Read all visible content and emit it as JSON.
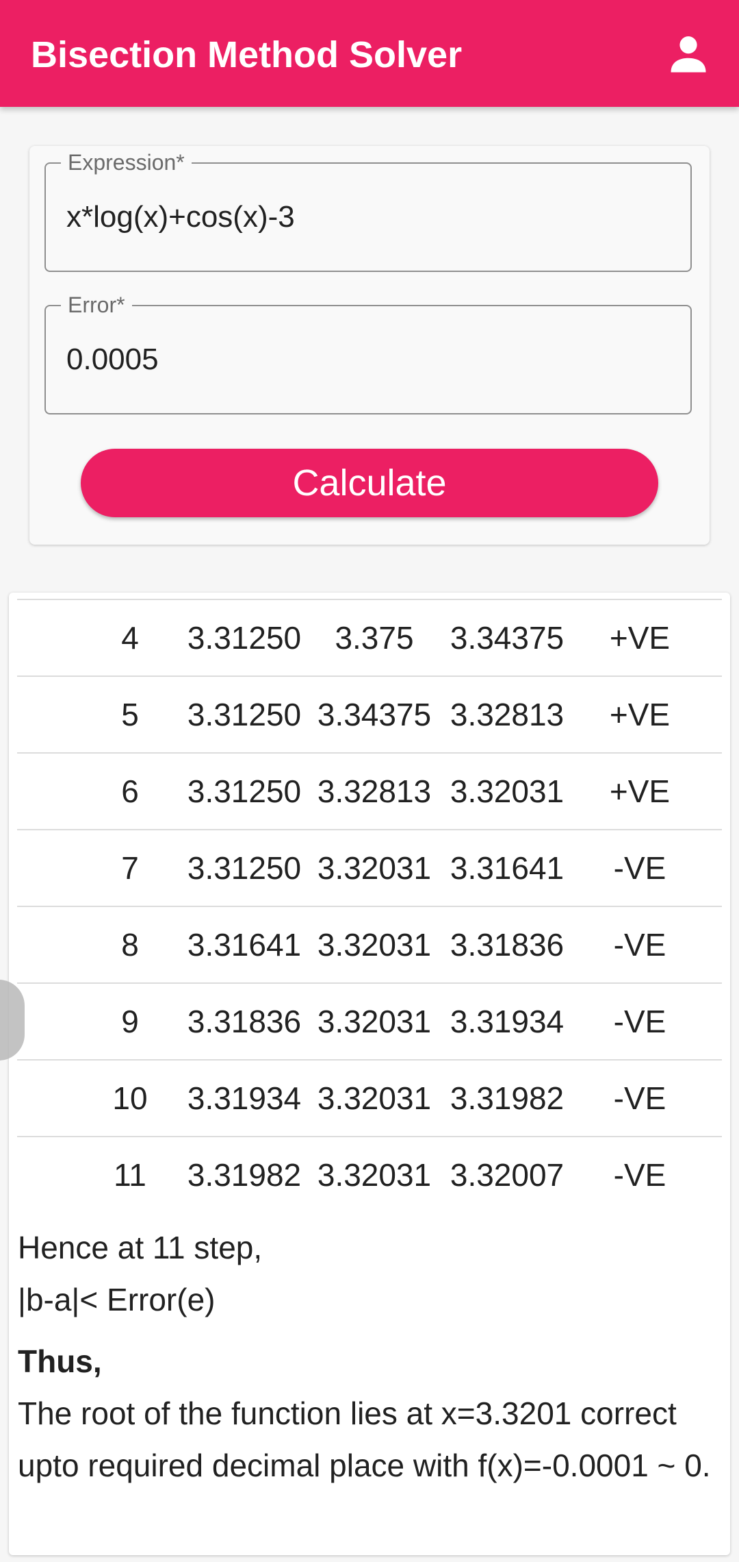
{
  "appbar": {
    "title": "Bisection Method Solver",
    "background": "#ec1f63",
    "account_icon": "account-icon"
  },
  "form": {
    "expression_label": "Expression*",
    "expression_value": "x*log(x)+cos(x)-3",
    "error_label": "Error*",
    "error_value": "0.0005",
    "calculate_label": "Calculate"
  },
  "table": {
    "rows": [
      {
        "n": "4",
        "a": "3.31250",
        "b": "3.375",
        "c": "3.34375",
        "sign": "+VE"
      },
      {
        "n": "5",
        "a": "3.31250",
        "b": "3.34375",
        "c": "3.32813",
        "sign": "+VE"
      },
      {
        "n": "6",
        "a": "3.31250",
        "b": "3.32813",
        "c": "3.32031",
        "sign": "+VE"
      },
      {
        "n": "7",
        "a": "3.31250",
        "b": "3.32031",
        "c": "3.31641",
        "sign": "-VE"
      },
      {
        "n": "8",
        "a": "3.31641",
        "b": "3.32031",
        "c": "3.31836",
        "sign": "-VE"
      },
      {
        "n": "9",
        "a": "3.31836",
        "b": "3.32031",
        "c": "3.31934",
        "sign": "-VE"
      },
      {
        "n": "10",
        "a": "3.31934",
        "b": "3.32031",
        "c": "3.31982",
        "sign": "-VE"
      },
      {
        "n": "11",
        "a": "3.31982",
        "b": "3.32031",
        "c": "3.32007",
        "sign": "-VE"
      }
    ]
  },
  "conclusion": {
    "step_line": "Hence at 11 step,",
    "condition_line": "|b-a|< Error(e)",
    "thus": "Thus,",
    "root_statement": "The root of the function lies at x=3.3201 correct upto required decimal place with f(x)=-0.0001 ~ 0."
  }
}
